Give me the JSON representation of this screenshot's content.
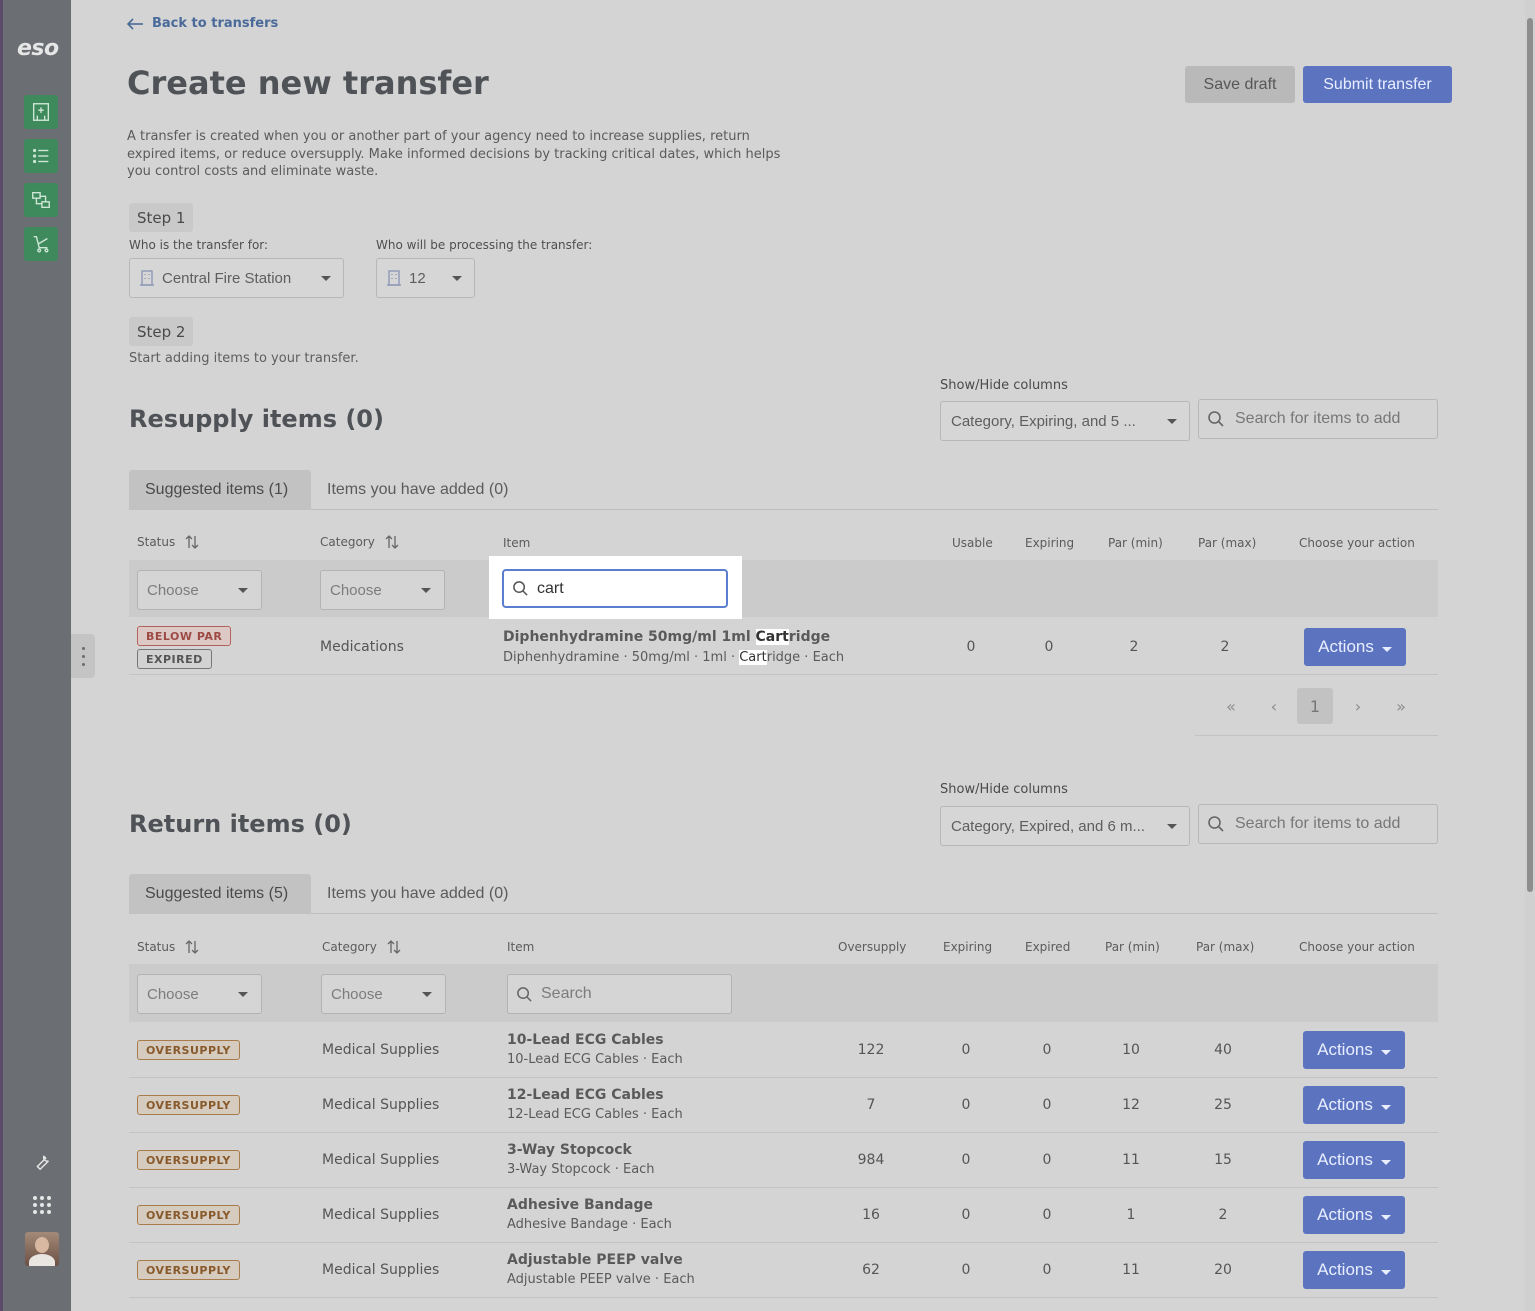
{
  "brand": {
    "logo": "eso"
  },
  "header": {
    "back_label": "Back to transfers",
    "title": "Create new transfer",
    "save_label": "Save draft",
    "submit_label": "Submit transfer",
    "intro": "A transfer is created when you or another part of your agency need to increase supplies, return expired items, or reduce oversupply. Make informed decisions by tracking critical dates, which helps you control costs and eliminate waste."
  },
  "step1": {
    "label": "Step 1",
    "for_label": "Who is the transfer for:",
    "for_value": "Central Fire Station",
    "processing_label": "Who will be processing the transfer:",
    "processing_value": "12"
  },
  "step2": {
    "label": "Step 2",
    "description": "Start adding items to your transfer."
  },
  "resupply": {
    "title": "Resupply items (0)",
    "show_hide_label": "Show/Hide columns",
    "columns_value": "Category, Expiring, and 5 ...",
    "search_placeholder": "Search for items to add",
    "tabs": [
      "Suggested items (1)",
      "Items you have added (0)"
    ],
    "headers": {
      "status": "Status",
      "category": "Category",
      "item": "Item",
      "usable": "Usable",
      "expiring": "Expiring",
      "par_min": "Par (min)",
      "par_max": "Par (max)",
      "action": "Choose your action"
    },
    "filter_choose": "Choose",
    "item_search_value": "cart",
    "rows": [
      {
        "badges": [
          "BELOW PAR",
          "EXPIRED"
        ],
        "category": "Medications",
        "name_pre": "Diphenhydramine 50mg/ml 1ml ",
        "name_mark": "Cart",
        "name_post": "ridge",
        "sub_pre": "Diphenhydramine · 50mg/ml · 1ml · ",
        "sub_mark": "Cart",
        "sub_post": "ridge · Each",
        "usable": "0",
        "expiring": "0",
        "par_min": "2",
        "par_max": "2",
        "action": "Actions"
      }
    ],
    "pager": {
      "first": "«",
      "prev": "‹",
      "current": "1",
      "next": "›",
      "last": "»"
    }
  },
  "returns": {
    "title": "Return items (0)",
    "show_hide_label": "Show/Hide columns",
    "columns_value": "Category, Expired, and 6 m...",
    "search_placeholder": "Search for items to add",
    "tabs": [
      "Suggested items (5)",
      "Items you have added (0)"
    ],
    "headers": {
      "status": "Status",
      "category": "Category",
      "item": "Item",
      "oversupply": "Oversupply",
      "expiring": "Expiring",
      "expired": "Expired",
      "par_min": "Par (min)",
      "par_max": "Par (max)",
      "action": "Choose your action"
    },
    "filter_choose": "Choose",
    "item_search_placeholder": "Search",
    "rows": [
      {
        "badge": "OVERSUPPLY",
        "category": "Medical Supplies",
        "name": "10-Lead ECG Cables",
        "sub": "10-Lead ECG Cables · Each",
        "oversupply": "122",
        "expiring": "0",
        "expired": "0",
        "par_min": "10",
        "par_max": "40",
        "action": "Actions"
      },
      {
        "badge": "OVERSUPPLY",
        "category": "Medical Supplies",
        "name": "12-Lead ECG Cables",
        "sub": "12-Lead ECG Cables · Each",
        "oversupply": "7",
        "expiring": "0",
        "expired": "0",
        "par_min": "12",
        "par_max": "25",
        "action": "Actions"
      },
      {
        "badge": "OVERSUPPLY",
        "category": "Medical Supplies",
        "name": "3-Way Stopcock",
        "sub": "3-Way Stopcock · Each",
        "oversupply": "984",
        "expiring": "0",
        "expired": "0",
        "par_min": "11",
        "par_max": "15",
        "action": "Actions"
      },
      {
        "badge": "OVERSUPPLY",
        "category": "Medical Supplies",
        "name": "Adhesive Bandage",
        "sub": "Adhesive Bandage · Each",
        "oversupply": "16",
        "expiring": "0",
        "expired": "0",
        "par_min": "1",
        "par_max": "2",
        "action": "Actions"
      },
      {
        "badge": "OVERSUPPLY",
        "category": "Medical Supplies",
        "name": "Adjustable PEEP valve",
        "sub": "Adjustable PEEP valve · Each",
        "oversupply": "62",
        "expiring": "0",
        "expired": "0",
        "par_min": "11",
        "par_max": "20",
        "action": "Actions"
      }
    ]
  },
  "icons": {
    "sidebar": [
      "building-add-icon",
      "list-icon",
      "transfer-icon",
      "cart-icon",
      "wrench-icon",
      "apps-grid-icon"
    ]
  },
  "colors": {
    "primary": "#5c74c0",
    "sidebar_button": "#3e8a5c",
    "link": "#4a6a9a"
  }
}
